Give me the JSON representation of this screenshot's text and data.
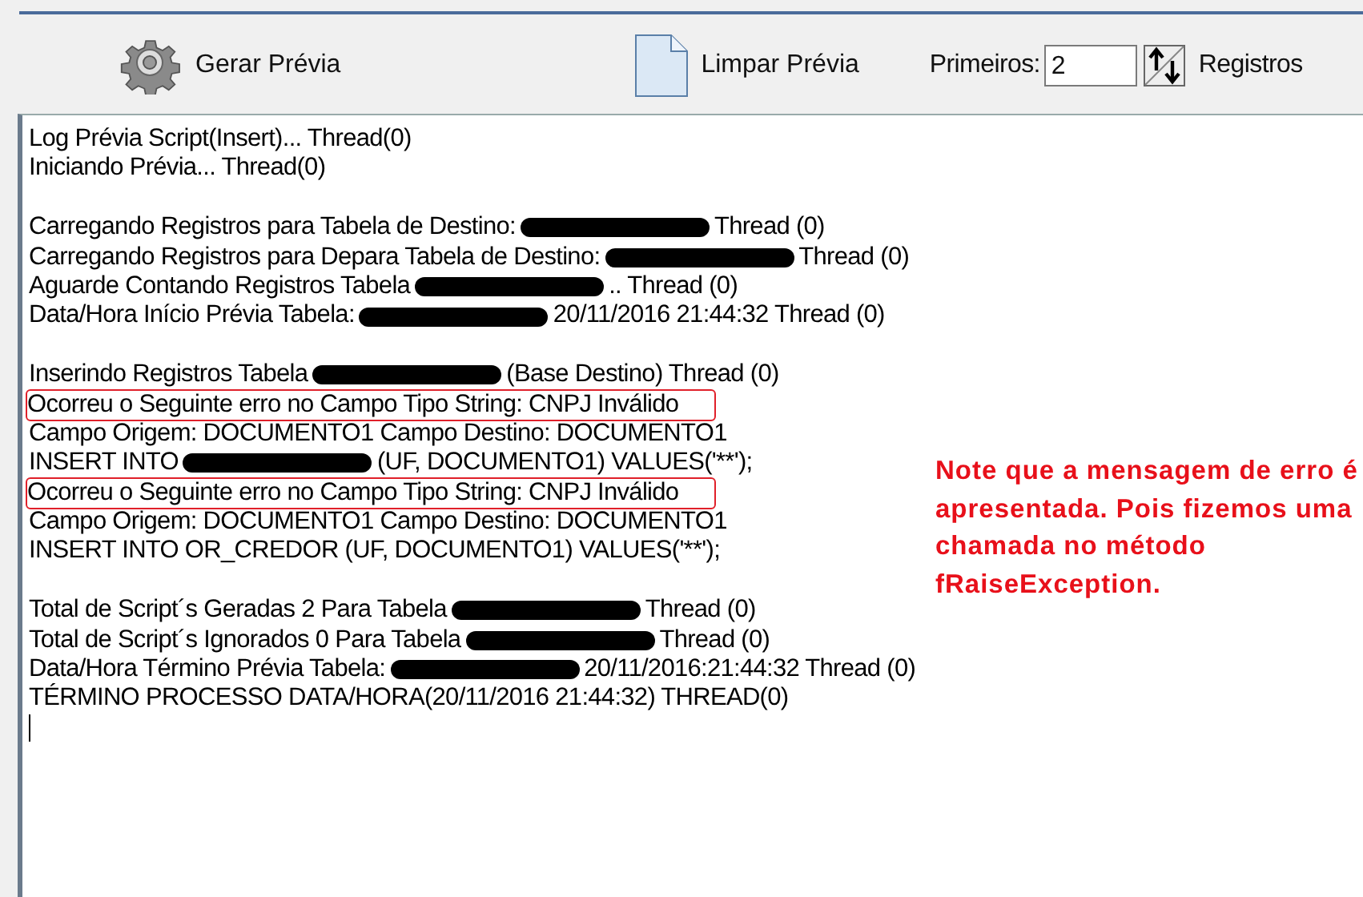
{
  "toolbar": {
    "generate_button": "Gerar Prévia",
    "clear_button": "Limpar Prévia",
    "count_label": "Primeiros:",
    "count_value": "2",
    "count_suffix": "Registros"
  },
  "log": {
    "lines": [
      {
        "kind": "text",
        "highlighted": false,
        "segments": [
          {
            "kind": "text",
            "text": "Log Prévia Script(Insert)... Thread(0)"
          }
        ]
      },
      {
        "kind": "text",
        "highlighted": false,
        "segments": [
          {
            "kind": "text",
            "text": "Iniciando Prévia... Thread(0)"
          }
        ]
      },
      {
        "kind": "blank"
      },
      {
        "kind": "text",
        "highlighted": false,
        "segments": [
          {
            "kind": "text",
            "text": "Carregando Registros para Tabela de Destino:"
          },
          {
            "kind": "redacted"
          },
          {
            "kind": "text",
            "text": "Thread (0)"
          }
        ]
      },
      {
        "kind": "text",
        "highlighted": false,
        "segments": [
          {
            "kind": "text",
            "text": "Carregando Registros para Depara Tabela de Destino:"
          },
          {
            "kind": "redacted"
          },
          {
            "kind": "text",
            "text": "Thread (0)"
          }
        ]
      },
      {
        "kind": "text",
        "highlighted": false,
        "segments": [
          {
            "kind": "text",
            "text": "Aguarde Contando Registros Tabela"
          },
          {
            "kind": "redacted"
          },
          {
            "kind": "text",
            "text": ".. Thread (0)"
          }
        ]
      },
      {
        "kind": "text",
        "highlighted": false,
        "segments": [
          {
            "kind": "text",
            "text": "Data/Hora Início Prévia Tabela:"
          },
          {
            "kind": "redacted"
          },
          {
            "kind": "text",
            "text": "20/11/2016 21:44:32 Thread (0)"
          }
        ]
      },
      {
        "kind": "blank"
      },
      {
        "kind": "text",
        "highlighted": false,
        "segments": [
          {
            "kind": "text",
            "text": "Inserindo Registros Tabela"
          },
          {
            "kind": "redacted"
          },
          {
            "kind": "text",
            "text": "(Base Destino) Thread (0)"
          }
        ]
      },
      {
        "kind": "text",
        "highlighted": true,
        "segments": [
          {
            "kind": "text",
            "text": "Ocorreu o Seguinte erro no Campo Tipo String: CNPJ Inválido"
          }
        ]
      },
      {
        "kind": "text",
        "highlighted": false,
        "segments": [
          {
            "kind": "text",
            "text": "Campo Origem: DOCUMENTO1 Campo Destino: DOCUMENTO1"
          }
        ]
      },
      {
        "kind": "text",
        "highlighted": false,
        "segments": [
          {
            "kind": "text",
            "text": "INSERT INTO"
          },
          {
            "kind": "redacted"
          },
          {
            "kind": "text",
            "text": "(UF, DOCUMENTO1) VALUES('**');"
          }
        ]
      },
      {
        "kind": "text",
        "highlighted": true,
        "segments": [
          {
            "kind": "text",
            "text": "Ocorreu o Seguinte erro no Campo Tipo String: CNPJ Inválido"
          }
        ]
      },
      {
        "kind": "text",
        "highlighted": false,
        "segments": [
          {
            "kind": "text",
            "text": "Campo Origem: DOCUMENTO1 Campo Destino: DOCUMENTO1"
          }
        ]
      },
      {
        "kind": "text",
        "highlighted": false,
        "segments": [
          {
            "kind": "text",
            "text": "INSERT INTO OR_CREDOR (UF, DOCUMENTO1) VALUES('**');"
          }
        ]
      },
      {
        "kind": "blank"
      },
      {
        "kind": "text",
        "highlighted": false,
        "segments": [
          {
            "kind": "text",
            "text": "Total de Script´s Geradas 2 Para Tabela"
          },
          {
            "kind": "redacted"
          },
          {
            "kind": "text",
            "text": "Thread (0)"
          }
        ]
      },
      {
        "kind": "text",
        "highlighted": false,
        "segments": [
          {
            "kind": "text",
            "text": "Total de Script´s Ignorados 0 Para Tabela"
          },
          {
            "kind": "redacted"
          },
          {
            "kind": "text",
            "text": "Thread (0)"
          }
        ]
      },
      {
        "kind": "text",
        "highlighted": false,
        "segments": [
          {
            "kind": "text",
            "text": "Data/Hora Término Prévia Tabela:"
          },
          {
            "kind": "redacted"
          },
          {
            "kind": "text",
            "text": "20/11/2016:21:44:32 Thread (0)"
          }
        ]
      },
      {
        "kind": "text",
        "highlighted": false,
        "segments": [
          {
            "kind": "text",
            "text": "TÉRMINO PROCESSO DATA/HORA(20/11/2016 21:44:32) THREAD(0)"
          }
        ]
      }
    ]
  },
  "annotation": "Note que a mensagem de erro é apresentada. Pois fizemos uma chamada no método fRaiseException."
}
